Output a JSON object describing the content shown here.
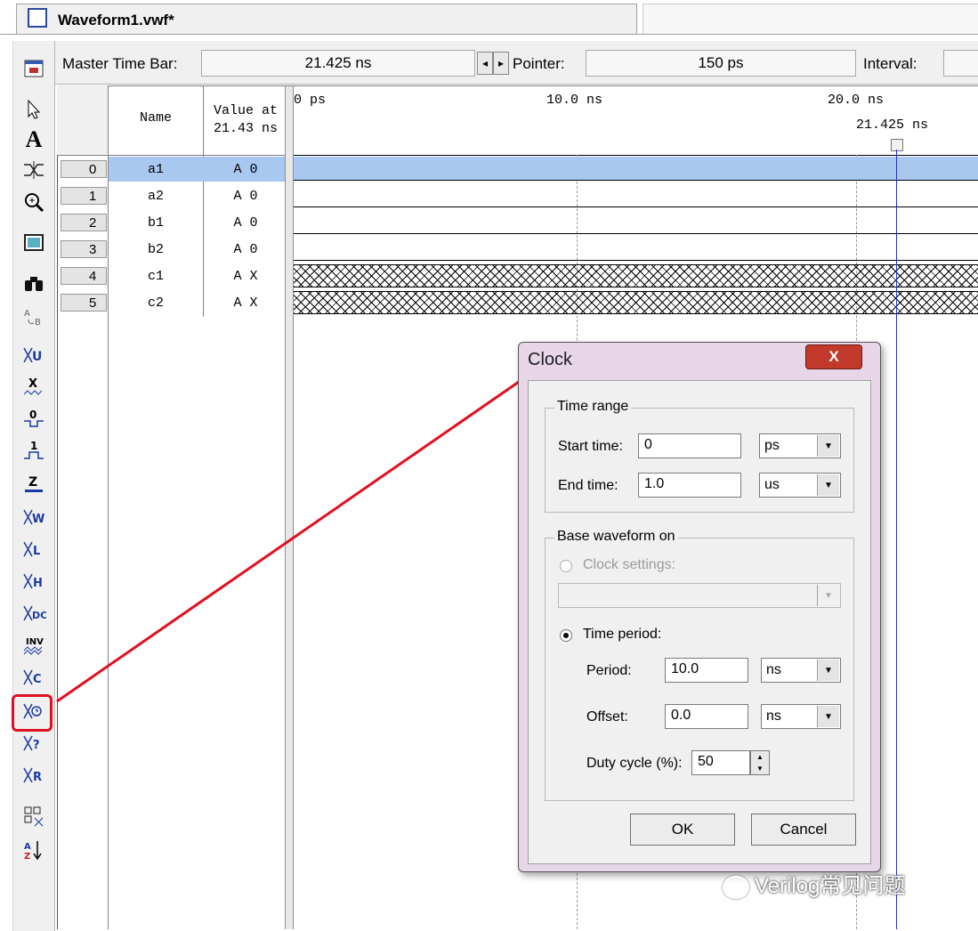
{
  "tab": {
    "title": "Waveform1.vwf*"
  },
  "master_bar": {
    "master_label": "Master Time Bar:",
    "master_value": "21.425 ns",
    "pointer_label": "Pointer:",
    "pointer_value": "150 ps",
    "interval_label": "Interval:"
  },
  "grid": {
    "name_header": "Name",
    "value_header_1": "Value at",
    "value_header_2": "21.43 ns",
    "ruler": [
      "0 ps",
      "10.0 ns",
      "20.0 ns"
    ],
    "cursor_label": "21.425 ns",
    "rows": [
      {
        "index": "0",
        "name": "a1",
        "value": "A 0"
      },
      {
        "index": "1",
        "name": "a2",
        "value": "A 0"
      },
      {
        "index": "2",
        "name": "b1",
        "value": "A 0"
      },
      {
        "index": "3",
        "name": "b2",
        "value": "A 0"
      },
      {
        "index": "4",
        "name": "c1",
        "value": "A X"
      },
      {
        "index": "5",
        "name": "c2",
        "value": "A X"
      }
    ]
  },
  "dialog": {
    "title": "Clock",
    "close": "X",
    "time_range": "Time range",
    "start_label": "Start time:",
    "start_value": "0",
    "start_unit": "ps",
    "end_label": "End time:",
    "end_value": "1.0",
    "end_unit": "us",
    "base_waveform": "Base waveform on",
    "clock_settings": "Clock settings:",
    "time_period": "Time period:",
    "period_label": "Period:",
    "period_value": "10.0",
    "period_unit": "ns",
    "offset_label": "Offset:",
    "offset_value": "0.0",
    "offset_unit": "ns",
    "duty_label": "Duty cycle (%):",
    "duty_value": "50",
    "ok": "OK",
    "cancel": "Cancel"
  },
  "toolbar_text": {
    "text_tool": "A"
  },
  "watermark": "Verilog常见问题",
  "colors": {
    "selection": "#a8c8f0",
    "cursor": "#2233cc",
    "annotation": "#e01020"
  }
}
